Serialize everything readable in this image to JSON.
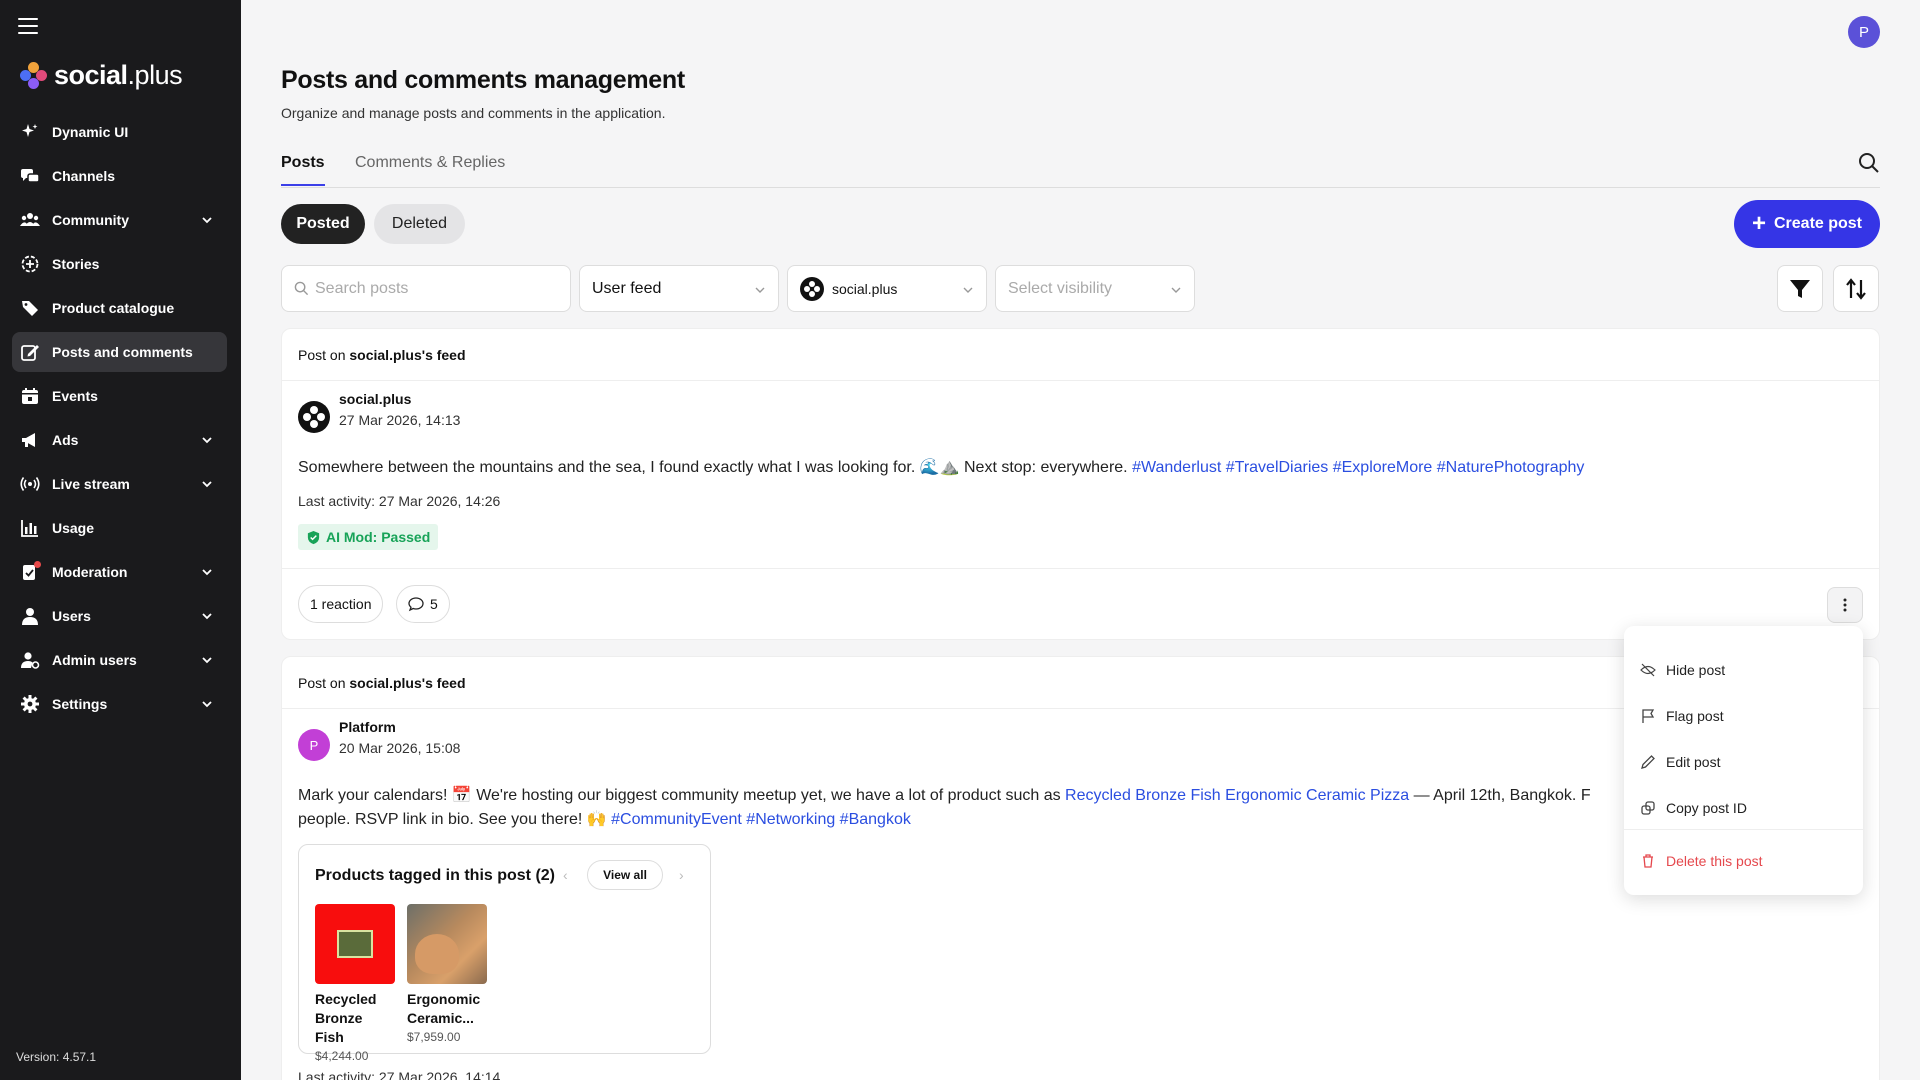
{
  "app": {
    "brand_bold": "social",
    "brand_light": ".plus",
    "version": "Version: 4.57.1",
    "user_initial": "P"
  },
  "sidebar": {
    "items": [
      {
        "label": "Dynamic UI",
        "icon": "sparkle-icon",
        "chevron": false
      },
      {
        "label": "Channels",
        "icon": "chat-bubbles-icon",
        "chevron": false
      },
      {
        "label": "Community",
        "icon": "community-icon",
        "chevron": true
      },
      {
        "label": "Stories",
        "icon": "stories-icon",
        "chevron": false
      },
      {
        "label": "Product catalogue",
        "icon": "tag-icon",
        "chevron": false
      },
      {
        "label": "Posts and comments",
        "icon": "edit-icon",
        "chevron": false,
        "active": true
      },
      {
        "label": "Events",
        "icon": "calendar-icon",
        "chevron": false
      },
      {
        "label": "Ads",
        "icon": "megaphone-icon",
        "chevron": true
      },
      {
        "label": "Live stream",
        "icon": "broadcast-icon",
        "chevron": true
      },
      {
        "label": "Usage",
        "icon": "bar-chart-icon",
        "chevron": false
      },
      {
        "label": "Moderation",
        "icon": "moderation-icon",
        "chevron": true,
        "notification_dot": true
      },
      {
        "label": "Users",
        "icon": "user-icon",
        "chevron": true
      },
      {
        "label": "Admin users",
        "icon": "admin-user-icon",
        "chevron": true
      },
      {
        "label": "Settings",
        "icon": "gear-icon",
        "chevron": true
      }
    ]
  },
  "header": {
    "title": "Posts and comments management",
    "subtitle": "Organize and manage posts and comments in the application."
  },
  "tabs": [
    {
      "label": "Posts",
      "active": true
    },
    {
      "label": "Comments & Replies",
      "active": false
    }
  ],
  "segments": {
    "posted": "Posted",
    "deleted": "Deleted"
  },
  "create_button": "Create post",
  "filters": {
    "search_placeholder": "Search posts",
    "feed": "User feed",
    "community": "social.plus",
    "visibility_placeholder": "Select visibility"
  },
  "posts": [
    {
      "feed_prefix": "Post on ",
      "feed_name": "social.plus's feed",
      "author": "social.plus",
      "date": "27 Mar 2026, 14:13",
      "text": "Somewhere between the mountains and the sea, I found exactly what I was looking for. 🌊⛰️ Next stop: everywhere. ",
      "hashtags": "#Wanderlust #TravelDiaries #ExploreMore #NaturePhotography",
      "last_activity": "Last activity: 27 Mar 2026, 14:26",
      "ai_mod": "AI Mod: Passed",
      "reactions": "1 reaction",
      "comments": "5"
    },
    {
      "feed_prefix": "Post on ",
      "feed_name": "social.plus's feed",
      "author": "Platform",
      "author_initial": "P",
      "date": "20 Mar 2026, 15:08",
      "text_before": "Mark your calendars! 📅 We're hosting our biggest community meetup yet, we have a lot of product such as ",
      "product_links": "Recycled Bronze Fish Ergonomic Ceramic Pizza",
      "text_after": " — April 12th, Bangkok. F",
      "text_line2": "people. RSVP link in bio. See you there! 🙌 ",
      "hashtags": "#CommunityEvent #Networking #Bangkok",
      "products_title": "Products tagged in this post (2)",
      "view_all": "View all",
      "products": [
        {
          "name": "Recycled Bronze Fish",
          "price": "$4,244.00"
        },
        {
          "name": "Ergonomic Ceramic...",
          "price": "$7,959.00"
        }
      ],
      "last_activity": "Last activity: 27 Mar 2026, 14:14"
    }
  ],
  "context_menu": {
    "hide": "Hide post",
    "flag": "Flag post",
    "edit": "Edit post",
    "copy": "Copy post ID",
    "delete": "Delete this post"
  },
  "colors": {
    "accent": "#3535e6",
    "sidebar_bg": "#1a1a1c",
    "link": "#2b4ee0",
    "success": "#18a358",
    "danger": "#e5484d"
  }
}
